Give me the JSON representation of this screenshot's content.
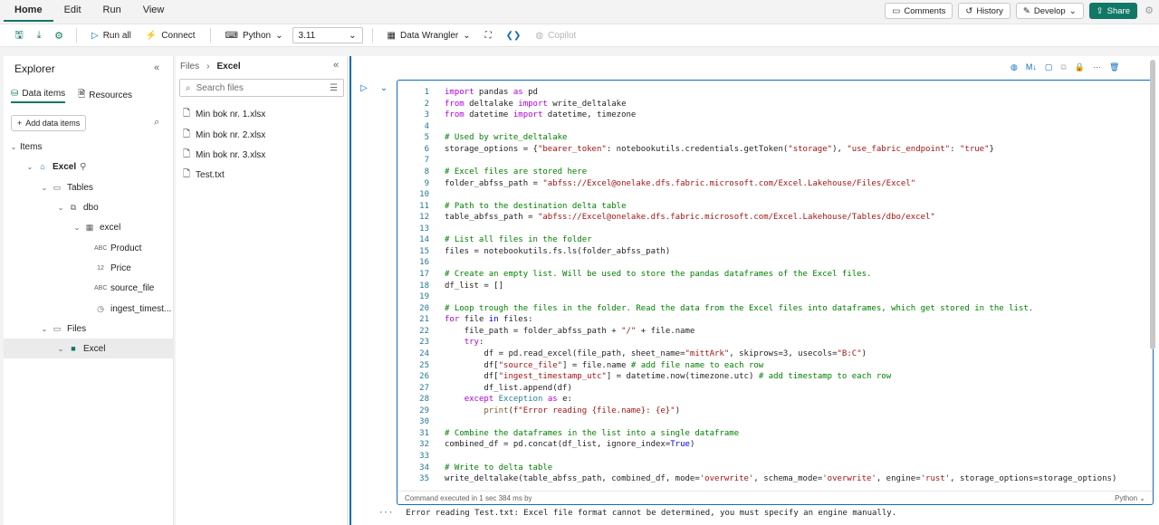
{
  "menu": {
    "tabs": [
      "Home",
      "Edit",
      "Run",
      "View"
    ]
  },
  "top_right": {
    "comments": "Comments",
    "history": "History",
    "develop": "Develop",
    "share": "Share"
  },
  "toolbar": {
    "run_all": "Run all",
    "connect": "Connect",
    "language": "Python",
    "version": "3.11",
    "data_wrangler": "Data Wrangler",
    "copilot": "Copilot"
  },
  "explorer": {
    "title": "Explorer",
    "tab_data": "Data items",
    "tab_resources": "Resources",
    "add": "Add data items",
    "tree": [
      {
        "label": "Items",
        "depth": 0
      },
      {
        "label": "Excel",
        "depth": 1
      },
      {
        "label": "Tables",
        "depth": 2
      },
      {
        "label": "dbo",
        "depth": 3
      },
      {
        "label": "excel",
        "depth": 4
      },
      {
        "label": "Product",
        "depth": 5,
        "type": "ABC"
      },
      {
        "label": "Price",
        "depth": 5,
        "type": "12"
      },
      {
        "label": "source_file",
        "depth": 5,
        "type": "ABC"
      },
      {
        "label": "ingest_timest...",
        "depth": 5
      },
      {
        "label": "Files",
        "depth": 2
      },
      {
        "label": "Excel",
        "depth": 3
      }
    ]
  },
  "files_panel": {
    "crumb_root": "Files",
    "crumb_current": "Excel",
    "search_placeholder": "Search files",
    "files": [
      "Min bok nr. 1.xlsx",
      "Min bok nr. 2.xlsx",
      "Min bok nr. 3.xlsx",
      "Test.txt"
    ]
  },
  "cell": {
    "line_numbers": [
      "1",
      "2",
      "3",
      "4",
      "5",
      "6",
      "7",
      "8",
      "9",
      "10",
      "11",
      "12",
      "13",
      "14",
      "15",
      "16",
      "17",
      "18",
      "19",
      "20",
      "21",
      "22",
      "23",
      "24",
      "25",
      "26",
      "27",
      "28",
      "29",
      "30",
      "31",
      "32",
      "33",
      "34",
      "35"
    ],
    "status": "Command executed in 1 sec 384 ms by",
    "lang": "Python"
  },
  "output": {
    "text": "Error reading Test.txt: Excel file format cannot be determined, you must specify an engine manually."
  }
}
